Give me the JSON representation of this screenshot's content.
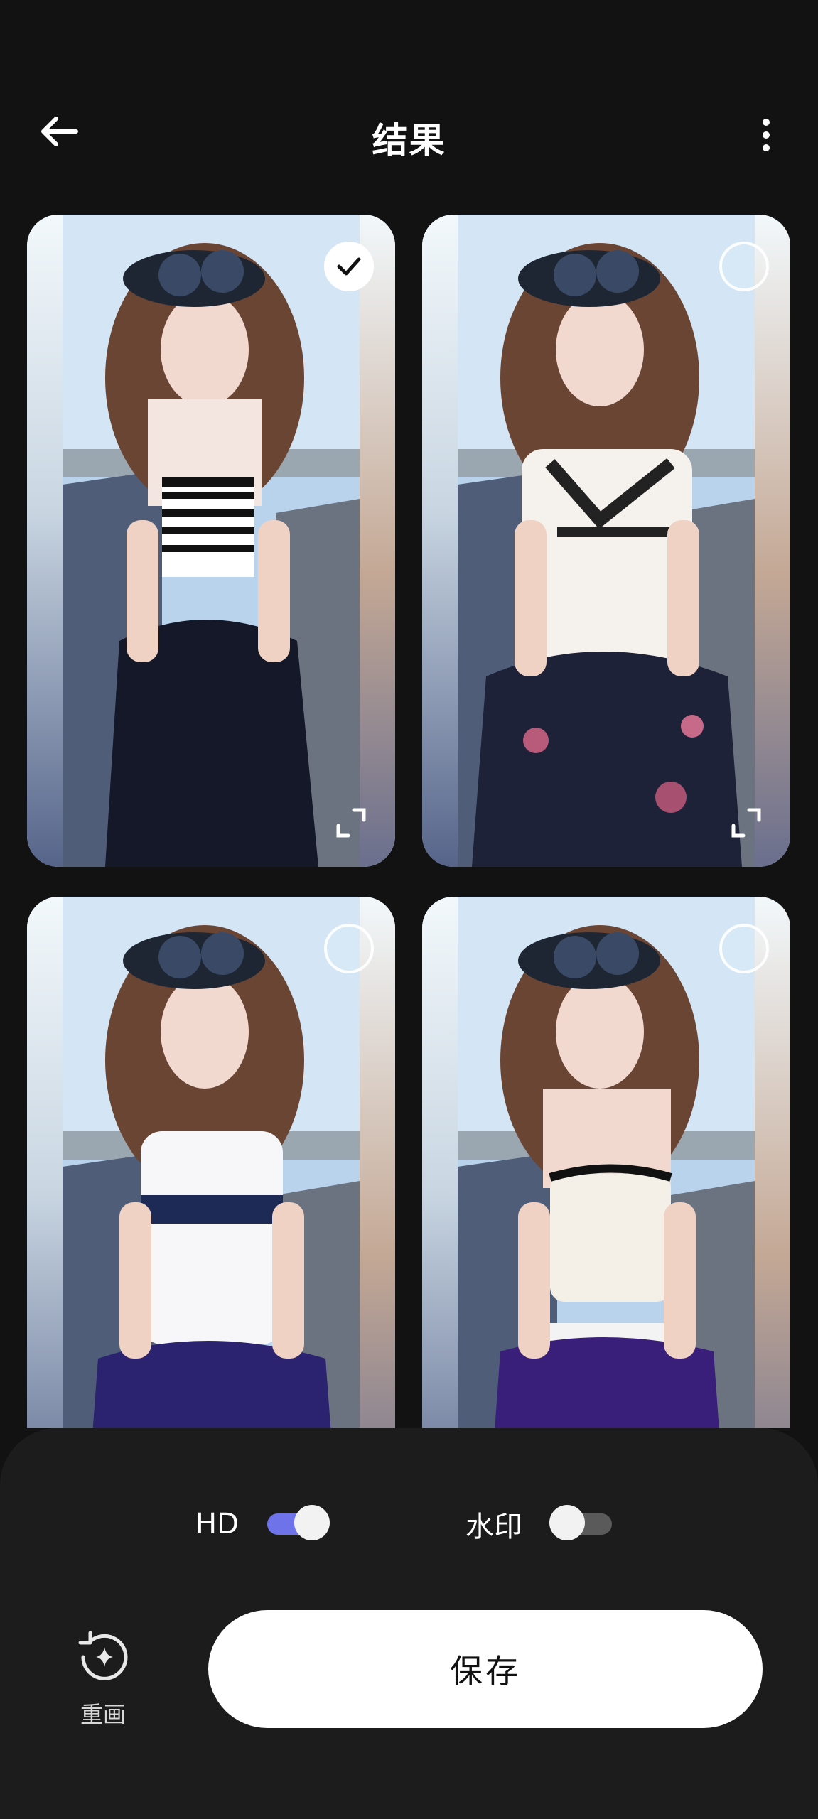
{
  "header": {
    "title": "结果",
    "back_icon": "arrow-left-icon",
    "more_icon": "more-vertical-icon"
  },
  "results": [
    {
      "selected": true,
      "top_style": "black-white striped crop top",
      "skirt": "navy"
    },
    {
      "selected": false,
      "top_style": "white top with black lace trim",
      "skirt": "navy floral"
    },
    {
      "selected": false,
      "top_style": "white sleeveless top with navy band",
      "skirt": "purple"
    },
    {
      "selected": false,
      "top_style": "white knit camisole",
      "skirt": "purple"
    }
  ],
  "settings": {
    "hd_label": "HD",
    "hd_enabled": true,
    "watermark_label": "水印",
    "watermark_enabled": false
  },
  "actions": {
    "redraw_label": "重画",
    "redraw_icon": "redraw-sparkle-icon",
    "save_label": "保存"
  },
  "colors": {
    "background": "#121212",
    "panel": "#1c1c1c",
    "accent": "#6f73ea",
    "save_button": "#ffffff"
  }
}
